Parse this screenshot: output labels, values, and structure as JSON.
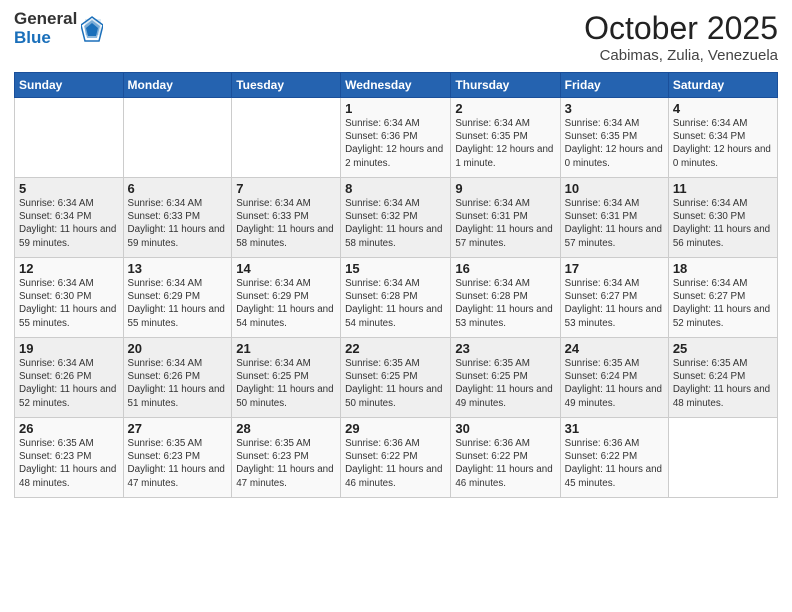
{
  "logo": {
    "general": "General",
    "blue": "Blue"
  },
  "header": {
    "month": "October 2025",
    "location": "Cabimas, Zulia, Venezuela"
  },
  "days_of_week": [
    "Sunday",
    "Monday",
    "Tuesday",
    "Wednesday",
    "Thursday",
    "Friday",
    "Saturday"
  ],
  "weeks": [
    [
      {
        "day": "",
        "info": ""
      },
      {
        "day": "",
        "info": ""
      },
      {
        "day": "",
        "info": ""
      },
      {
        "day": "1",
        "info": "Sunrise: 6:34 AM\nSunset: 6:36 PM\nDaylight: 12 hours\nand 2 minutes."
      },
      {
        "day": "2",
        "info": "Sunrise: 6:34 AM\nSunset: 6:35 PM\nDaylight: 12 hours\nand 1 minute."
      },
      {
        "day": "3",
        "info": "Sunrise: 6:34 AM\nSunset: 6:35 PM\nDaylight: 12 hours\nand 0 minutes."
      },
      {
        "day": "4",
        "info": "Sunrise: 6:34 AM\nSunset: 6:34 PM\nDaylight: 12 hours\nand 0 minutes."
      }
    ],
    [
      {
        "day": "5",
        "info": "Sunrise: 6:34 AM\nSunset: 6:34 PM\nDaylight: 11 hours\nand 59 minutes."
      },
      {
        "day": "6",
        "info": "Sunrise: 6:34 AM\nSunset: 6:33 PM\nDaylight: 11 hours\nand 59 minutes."
      },
      {
        "day": "7",
        "info": "Sunrise: 6:34 AM\nSunset: 6:33 PM\nDaylight: 11 hours\nand 58 minutes."
      },
      {
        "day": "8",
        "info": "Sunrise: 6:34 AM\nSunset: 6:32 PM\nDaylight: 11 hours\nand 58 minutes."
      },
      {
        "day": "9",
        "info": "Sunrise: 6:34 AM\nSunset: 6:31 PM\nDaylight: 11 hours\nand 57 minutes."
      },
      {
        "day": "10",
        "info": "Sunrise: 6:34 AM\nSunset: 6:31 PM\nDaylight: 11 hours\nand 57 minutes."
      },
      {
        "day": "11",
        "info": "Sunrise: 6:34 AM\nSunset: 6:30 PM\nDaylight: 11 hours\nand 56 minutes."
      }
    ],
    [
      {
        "day": "12",
        "info": "Sunrise: 6:34 AM\nSunset: 6:30 PM\nDaylight: 11 hours\nand 55 minutes."
      },
      {
        "day": "13",
        "info": "Sunrise: 6:34 AM\nSunset: 6:29 PM\nDaylight: 11 hours\nand 55 minutes."
      },
      {
        "day": "14",
        "info": "Sunrise: 6:34 AM\nSunset: 6:29 PM\nDaylight: 11 hours\nand 54 minutes."
      },
      {
        "day": "15",
        "info": "Sunrise: 6:34 AM\nSunset: 6:28 PM\nDaylight: 11 hours\nand 54 minutes."
      },
      {
        "day": "16",
        "info": "Sunrise: 6:34 AM\nSunset: 6:28 PM\nDaylight: 11 hours\nand 53 minutes."
      },
      {
        "day": "17",
        "info": "Sunrise: 6:34 AM\nSunset: 6:27 PM\nDaylight: 11 hours\nand 53 minutes."
      },
      {
        "day": "18",
        "info": "Sunrise: 6:34 AM\nSunset: 6:27 PM\nDaylight: 11 hours\nand 52 minutes."
      }
    ],
    [
      {
        "day": "19",
        "info": "Sunrise: 6:34 AM\nSunset: 6:26 PM\nDaylight: 11 hours\nand 52 minutes."
      },
      {
        "day": "20",
        "info": "Sunrise: 6:34 AM\nSunset: 6:26 PM\nDaylight: 11 hours\nand 51 minutes."
      },
      {
        "day": "21",
        "info": "Sunrise: 6:34 AM\nSunset: 6:25 PM\nDaylight: 11 hours\nand 50 minutes."
      },
      {
        "day": "22",
        "info": "Sunrise: 6:35 AM\nSunset: 6:25 PM\nDaylight: 11 hours\nand 50 minutes."
      },
      {
        "day": "23",
        "info": "Sunrise: 6:35 AM\nSunset: 6:25 PM\nDaylight: 11 hours\nand 49 minutes."
      },
      {
        "day": "24",
        "info": "Sunrise: 6:35 AM\nSunset: 6:24 PM\nDaylight: 11 hours\nand 49 minutes."
      },
      {
        "day": "25",
        "info": "Sunrise: 6:35 AM\nSunset: 6:24 PM\nDaylight: 11 hours\nand 48 minutes."
      }
    ],
    [
      {
        "day": "26",
        "info": "Sunrise: 6:35 AM\nSunset: 6:23 PM\nDaylight: 11 hours\nand 48 minutes."
      },
      {
        "day": "27",
        "info": "Sunrise: 6:35 AM\nSunset: 6:23 PM\nDaylight: 11 hours\nand 47 minutes."
      },
      {
        "day": "28",
        "info": "Sunrise: 6:35 AM\nSunset: 6:23 PM\nDaylight: 11 hours\nand 47 minutes."
      },
      {
        "day": "29",
        "info": "Sunrise: 6:36 AM\nSunset: 6:22 PM\nDaylight: 11 hours\nand 46 minutes."
      },
      {
        "day": "30",
        "info": "Sunrise: 6:36 AM\nSunset: 6:22 PM\nDaylight: 11 hours\nand 46 minutes."
      },
      {
        "day": "31",
        "info": "Sunrise: 6:36 AM\nSunset: 6:22 PM\nDaylight: 11 hours\nand 45 minutes."
      },
      {
        "day": "",
        "info": ""
      }
    ]
  ]
}
